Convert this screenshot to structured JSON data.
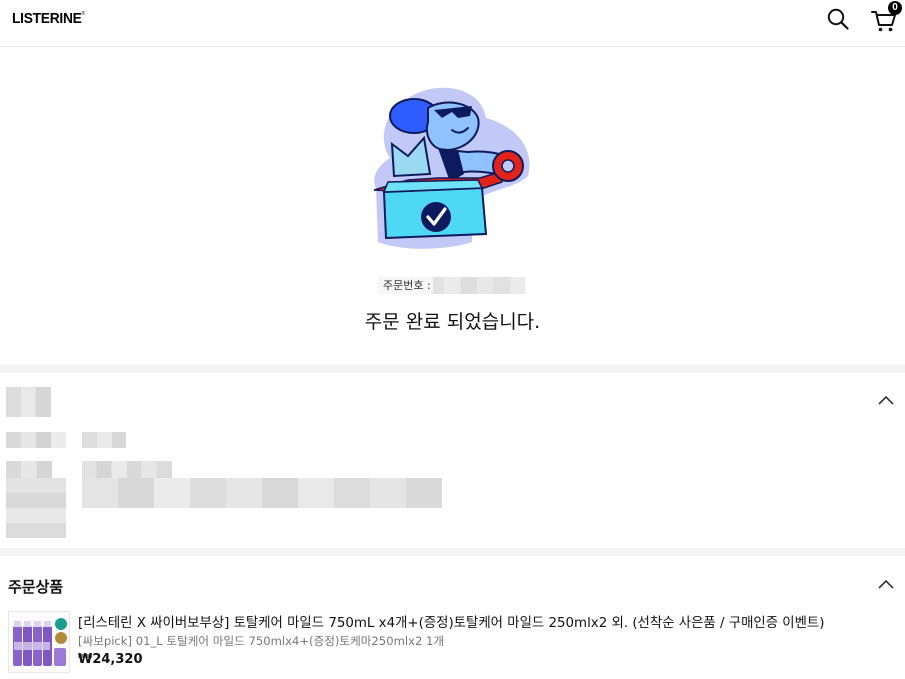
{
  "header": {
    "logo": "LISTERINE",
    "logo_mark": "®",
    "cart_count": "0",
    "icons": [
      "search-icon",
      "cart-icon"
    ]
  },
  "completion": {
    "order_number_label": "주문번호 : 2",
    "message": "주문 완료 되었습니다."
  },
  "order_products": {
    "title": "주문상품",
    "item": {
      "name": "[리스테린 X 싸이버보부상] 토탈케어 마일드 750mL x4개+(증정)토탈케어 마일드 250mlx2 외. (선착순 사은품 / 구매인증 이벤트)",
      "option": "[싸보pick] 01_L 토탈케어 마일드 750mlx4+(증정)토케마250mlx2 1개",
      "price": "₩24,320"
    }
  },
  "colors": {
    "accent_blue": "#2f5cff",
    "box_cyan": "#4fd8f4",
    "ribbon_red": "#e2231a",
    "halo_lavender": "#c3c9f6",
    "section_gap": "#f4f4f4"
  }
}
